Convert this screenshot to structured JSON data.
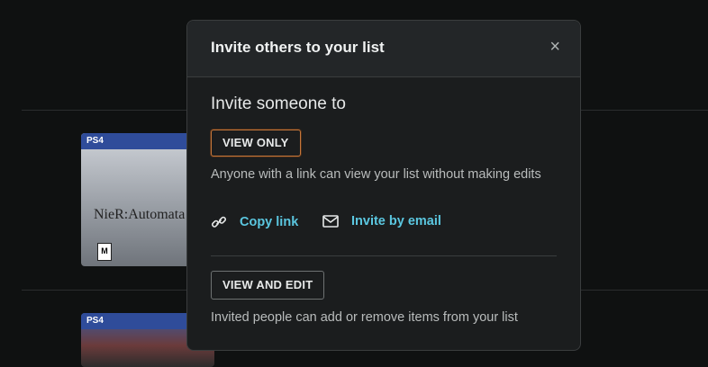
{
  "modal": {
    "title": "Invite others to your list",
    "close_symbol": "×",
    "section_title": "Invite someone to",
    "view_only": {
      "label": "VIEW ONLY",
      "description": "Anyone with a link can view your list without making edits"
    },
    "actions": {
      "copy_link": "Copy link",
      "invite_email": "Invite by email"
    },
    "view_edit": {
      "label": "VIEW AND EDIT",
      "description": "Invited people can add or remove items from your list"
    }
  },
  "background": {
    "items": [
      {
        "platform": "PS4",
        "title_fragment": "NieR:Automata",
        "rating": "M"
      },
      {
        "platform": "PS4"
      }
    ]
  },
  "colors": {
    "accent_link": "#5bc7e0",
    "selected_border": "#c7773a",
    "modal_bg": "#1b1d1e"
  }
}
